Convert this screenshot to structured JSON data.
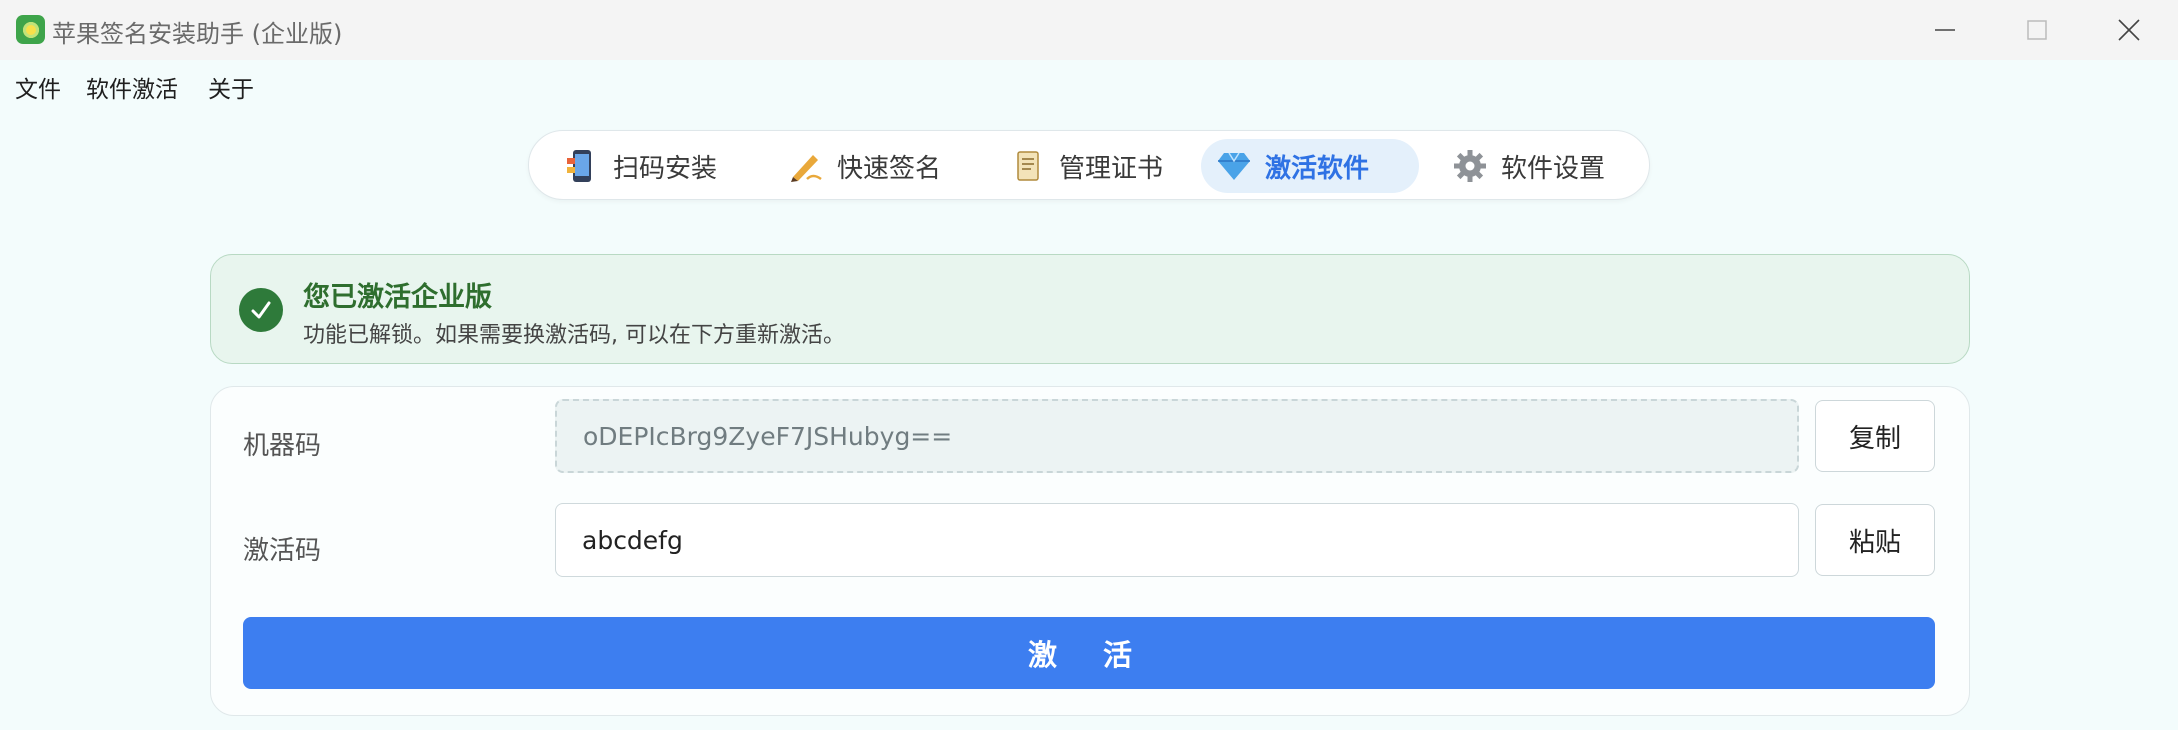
{
  "window": {
    "title": "苹果签名安装助手 (企业版)",
    "controls": [
      "minimize",
      "maximize",
      "close"
    ]
  },
  "menu": {
    "items": [
      {
        "label": "文件"
      },
      {
        "label": "软件激活"
      },
      {
        "label": "关于"
      }
    ]
  },
  "tabs": [
    {
      "label": "扫码安装",
      "icon": "phone-qr-icon",
      "active": false
    },
    {
      "label": "快速签名",
      "icon": "pen-sign-icon",
      "active": false
    },
    {
      "label": "管理证书",
      "icon": "scroll-certificate-icon",
      "active": false
    },
    {
      "label": "激活软件",
      "icon": "diamond-icon",
      "active": true
    },
    {
      "label": "软件设置",
      "icon": "gear-icon",
      "active": false
    }
  ],
  "banner": {
    "title": "您已激活企业版",
    "description": "功能已解锁。如果需要换激活码, 可以在下方重新激活。",
    "color": "#2e7a3a"
  },
  "form": {
    "machine_code": {
      "label": "机器码",
      "value": "oDEPIcBrg9ZyeF7JSHubyg==",
      "button": "复制"
    },
    "activation_code": {
      "label": "激活码",
      "value": "abcdefg",
      "button": "粘贴"
    },
    "submit": "激 活"
  },
  "colors": {
    "accent": "#3d7ef0",
    "success": "#2e7a3a",
    "background": "#f3fcfc"
  }
}
